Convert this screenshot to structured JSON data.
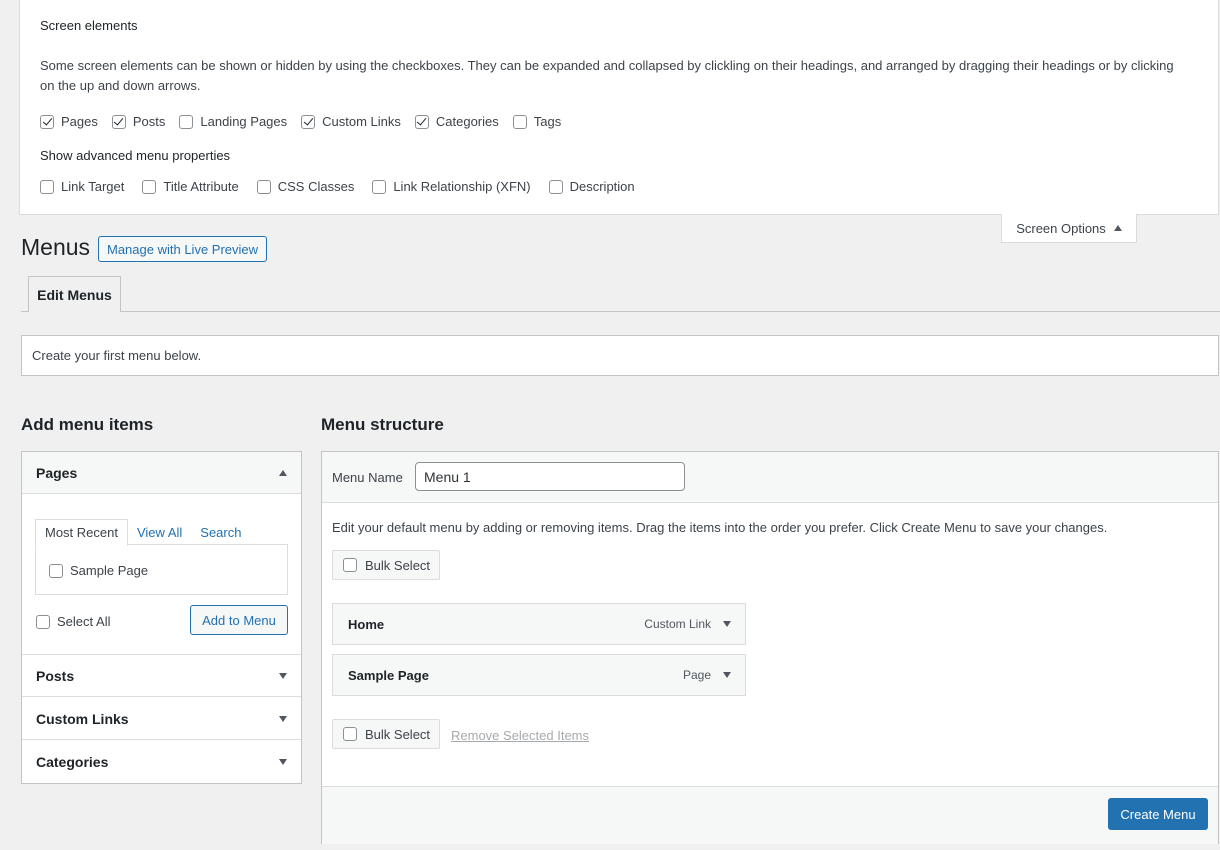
{
  "screen_options": {
    "heading": "Screen elements",
    "description": "Some screen elements can be shown or hidden by using the checkboxes. They can be expanded and collapsed by clickling on their headings, and arranged by dragging their headings or by clicking on the up and down arrows.",
    "elements": [
      {
        "label": "Pages",
        "checked": true
      },
      {
        "label": "Posts",
        "checked": true
      },
      {
        "label": "Landing Pages",
        "checked": false
      },
      {
        "label": "Custom Links",
        "checked": true
      },
      {
        "label": "Categories",
        "checked": true
      },
      {
        "label": "Tags",
        "checked": false
      }
    ],
    "advanced_heading": "Show advanced menu properties",
    "advanced": [
      {
        "label": "Link Target",
        "checked": false
      },
      {
        "label": "Title Attribute",
        "checked": false
      },
      {
        "label": "CSS Classes",
        "checked": false
      },
      {
        "label": "Link Relationship (XFN)",
        "checked": false
      },
      {
        "label": "Description",
        "checked": false
      }
    ],
    "tab_label": "Screen Options",
    "tab_icon": "arrow-up-icon"
  },
  "page": {
    "title": "Menus",
    "live_preview_label": "Manage with Live Preview",
    "tab_label": "Edit Menus",
    "notice": "Create your first menu below."
  },
  "add_items": {
    "heading": "Add menu items",
    "pages": {
      "label": "Pages",
      "tabs": [
        "Most Recent",
        "View All",
        "Search"
      ],
      "items": [
        {
          "label": "Sample Page",
          "checked": false
        }
      ],
      "select_all_label": "Select All",
      "add_button_label": "Add to Menu"
    },
    "sections": [
      "Posts",
      "Custom Links",
      "Categories"
    ]
  },
  "menu_structure": {
    "heading": "Menu structure",
    "name_label": "Menu Name",
    "name_value": "Menu 1",
    "instructions": "Edit your default menu by adding or removing items. Drag the items into the order you prefer. Click Create Menu to save your changes.",
    "bulk_select_label": "Bulk Select",
    "items": [
      {
        "title": "Home",
        "type": "Custom Link"
      },
      {
        "title": "Sample Page",
        "type": "Page"
      }
    ],
    "remove_selected_label": "Remove Selected Items",
    "create_button_label": "Create Menu"
  },
  "colors": {
    "accent": "#2271b1",
    "background": "#f0f0f1",
    "panel": "#ffffff",
    "border": "#c3c4c7"
  }
}
